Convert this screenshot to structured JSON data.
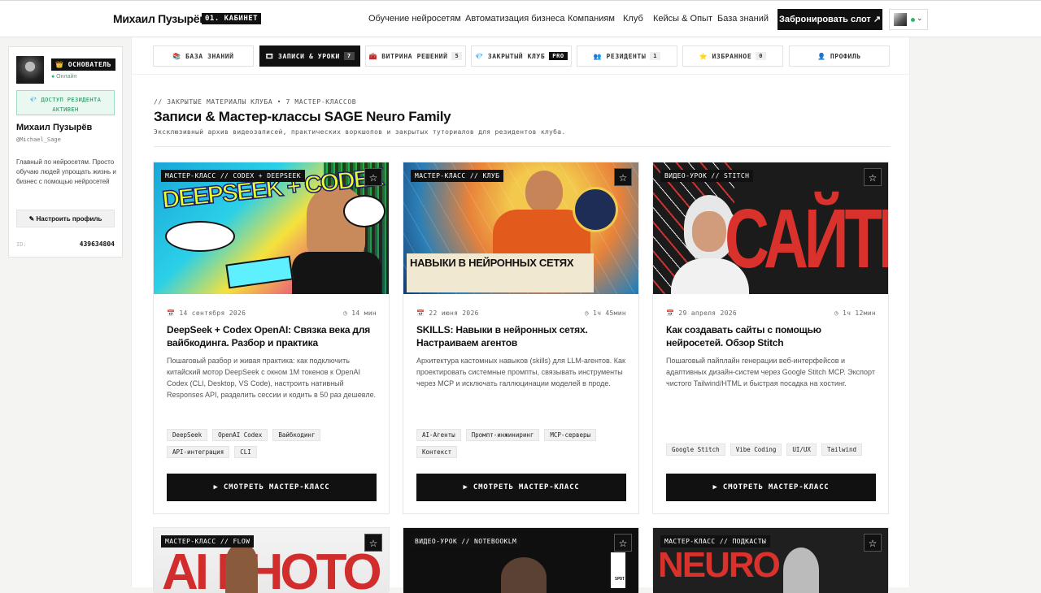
{
  "header": {
    "logo": "Михаил Пузырёв",
    "cabinet_badge": "01. КАБИНЕТ",
    "nav": [
      "Обучение нейросетям",
      "Автоматизация бизнеса",
      "Компаниям",
      "Клуб",
      "Кейсы & Опыт",
      "База знаний"
    ],
    "cta": "Забронировать слот ↗"
  },
  "sidebar": {
    "badge": "👑 ОСНОВАТЕЛЬ",
    "status": "● Онлайн",
    "access": "💎 ДОСТУП РЕЗИДЕНТА АКТИВЕН",
    "name": "Михаил Пузырёв",
    "handle": "@Michael_Sage",
    "bio": "Главный по нейросетям. Просто обучаю людей упрощать жизнь и бизнес с помощью нейросетей",
    "settings": "✎ Настроить профиль",
    "id_label": "ID:",
    "id_value": "439634804"
  },
  "tabs": [
    {
      "icon": "📚",
      "label": "БАЗА ЗНАНИЙ",
      "count": ""
    },
    {
      "icon": "🎞",
      "label": "ЗАПИСИ & УРОКИ",
      "count": "7"
    },
    {
      "icon": "🧰",
      "label": "ВИТРИНА РЕШЕНИЙ",
      "count": "5"
    },
    {
      "icon": "💎",
      "label": "ЗАКРЫТЫЙ КЛУБ",
      "count": "PRO"
    },
    {
      "icon": "👥",
      "label": "РЕЗИДЕНТЫ",
      "count": "1"
    },
    {
      "icon": "⭐",
      "label": "ИЗБРАННОЕ",
      "count": "0"
    },
    {
      "icon": "👤",
      "label": "ПРОФИЛЬ",
      "count": ""
    }
  ],
  "section": {
    "eyebrow": "// ЗАКРЫТЫЕ МАТЕРИАЛЫ КЛУБА • 7 МАСТЕР-КЛАССОВ",
    "title": "Записи & Мастер-классы SAGE Neuro Family",
    "subtitle": "Эксклюзивный архив видеозаписей, практических воркшопов и закрытых туториалов для резидентов клуба."
  },
  "cards": [
    {
      "tag": "МАСТЕР-КЛАСС // CODEX + DEEPSEEK",
      "art": "DEEPSEEK + CODEX",
      "date": "📅 14 сентября 2026",
      "duration": "◷ 14 мин",
      "title": "DeepSeek + Codex OpenAI: Связка века для вайбкодинга. Разбор и практика",
      "desc": "Пошаговый разбор и живая практика: как подключить китайский мотор DeepSeek с окном 1M токенов к OpenAI Codex (CLI, Desktop, VS Code), настроить нативный Responses API, разделить сессии и кодить в 50 раз дешевле.",
      "tags": [
        "DeepSeek",
        "OpenAI Codex",
        "Вайбкодинг",
        "API-интеграция",
        "CLI"
      ],
      "cta": "▶ СМОТРЕТЬ МАСТЕР-КЛАСС"
    },
    {
      "tag": "МАСТЕР-КЛАСС // КЛУБ",
      "art": "НАВЫКИ В НЕЙРОННЫХ СЕТЯХ",
      "date": "📅 22 июня 2026",
      "duration": "◷ 1ч 45мин",
      "title": "SKILLS: Навыки в нейронных сетях. Настраиваем агентов",
      "desc": "Архитектура кастомных навыков (skills) для LLM-агентов. Как проектировать системные промпты, связывать инструменты через MCP и исключать галлюцинации моделей в проде.",
      "tags": [
        "AI-Агенты",
        "Промпт-инжиниринг",
        "MCP-серверы",
        "Контекст"
      ],
      "cta": "▶ СМОТРЕТЬ МАСТЕР-КЛАСС"
    },
    {
      "tag": "ВИДЕО-УРОК // STITCH",
      "art": "САЙТЫ",
      "date": "📅 29 апреля 2026",
      "duration": "◷ 1ч 12мин",
      "title": "Как создавать сайты с помощью нейросетей. Обзор Stitch",
      "desc": "Пошаговый пайплайн генерации веб-интерфейсов и адаптивных дизайн-систем через Google Stitch MCP. Экспорт чистого Tailwind/HTML и быстрая посадка на хостинг.",
      "tags": [
        "Google Stitch",
        "Vibe Coding",
        "UI/UX",
        "Tailwind"
      ],
      "cta": "▶ СМОТРЕТЬ МАСТЕР-КЛАСС"
    },
    {
      "tag": "МАСТЕР-КЛАСС // FLOW",
      "art": "AI PHOTO"
    },
    {
      "tag": "ВИДЕО-УРОК // NOTEBOOKLM",
      "art": "SPOT"
    },
    {
      "tag": "МАСТЕР-КЛАСС // ПОДКАСТЫ",
      "art": "NEURO"
    }
  ],
  "colors": {
    "accent": "#111111",
    "online": "#2fb36b",
    "access_bg": "#e9f8f1"
  }
}
